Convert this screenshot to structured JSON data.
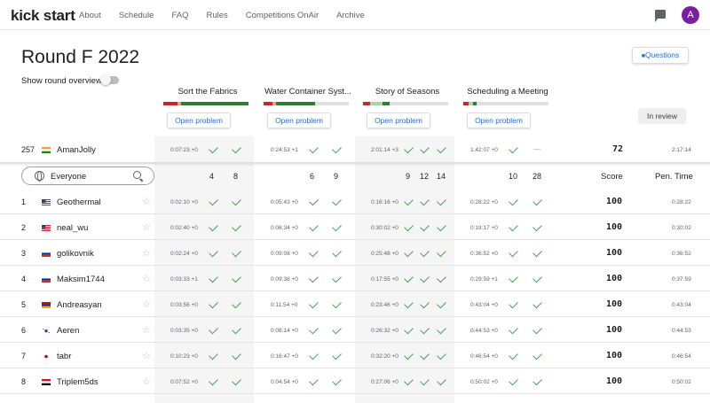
{
  "nav": {
    "logo": "kick start",
    "links": [
      "About",
      "Schedule",
      "FAQ",
      "Rules",
      "Competitions OnAir",
      "Archive"
    ],
    "avatar_letter": "A",
    "icons": [
      "feedback-icon"
    ]
  },
  "header": {
    "title": "Round F 2022",
    "questions_label": "Questions",
    "overview_label": "Show round overview",
    "review_label": "In review"
  },
  "problems": [
    {
      "name": "Sort the Fabrics",
      "open_label": "Open problem",
      "bar": [
        "#c62828",
        "#ef9a9a",
        "#2e7d32",
        "#2e7d32"
      ]
    },
    {
      "name": "Water Container Syst...",
      "open_label": "Open problem",
      "bar": [
        "#c62828",
        "#ef9a9a",
        "#2e7d32",
        "#e0e0e0"
      ]
    },
    {
      "name": "Story of Seasons",
      "open_label": "Open problem",
      "bar": [
        "#c62828",
        "#a5d6a7",
        "#2e7d32",
        "#e0e0e0"
      ]
    },
    {
      "name": "Scheduling a Meeting",
      "open_label": "Open problem",
      "bar": [
        "#c62828",
        "#a5d6a7",
        "#2e7d32",
        "#e0e0e0"
      ]
    }
  ],
  "my_row": {
    "rank": "257",
    "flag": "IN",
    "name": "AmanJolly",
    "times": [
      "0:07:23 +0",
      "0:24:53 +1",
      "2:01:14 +3",
      "1:42:07 +0"
    ],
    "placeholder_dash": "—",
    "score": "72",
    "penalty": "2:17:14"
  },
  "filter": {
    "value": "Everyone",
    "counts": [
      "4",
      "8",
      "6",
      "9",
      "9",
      "12",
      "14",
      "10",
      "28"
    ],
    "score_label": "Score",
    "pen_label": "Pen. Time"
  },
  "rows": [
    {
      "rank": "1",
      "flag": "US",
      "name": "Geothermal",
      "times": [
        "0:02:10 +0",
        "0:05:43 +0",
        "0:16:16 +0",
        "0:28:22 +0"
      ],
      "score": "100",
      "penalty": "0:28:22"
    },
    {
      "rank": "2",
      "flag": "US",
      "name": "neal_wu",
      "times": [
        "0:02:40 +0",
        "0:06:34 +0",
        "0:30:02 +0",
        "0:19:17 +0"
      ],
      "score": "100",
      "penalty": "0:30:02"
    },
    {
      "rank": "3",
      "flag": "RU",
      "name": "golikovnik",
      "times": [
        "0:02:24 +0",
        "0:09:08 +0",
        "0:25:48 +0",
        "0:36:52 +0"
      ],
      "score": "100",
      "penalty": "0:36:52"
    },
    {
      "rank": "4",
      "flag": "RU",
      "name": "Maksim1744",
      "times": [
        "0:03:33 +1",
        "0:09:38 +0",
        "0:17:55 +0",
        "0:29:59 +1"
      ],
      "score": "100",
      "penalty": "0:37:59"
    },
    {
      "rank": "5",
      "flag": "AM",
      "name": "Andreasyan",
      "times": [
        "0:03:56 +0",
        "0:11:54 +0",
        "0:23:46 +0",
        "0:43:04 +0"
      ],
      "score": "100",
      "penalty": "0:43:04"
    },
    {
      "rank": "6",
      "flag": "KR",
      "name": "Aeren",
      "times": [
        "0:03:35 +0",
        "0:08:14 +0",
        "0:26:32 +0",
        "0:44:53 +0"
      ],
      "score": "100",
      "penalty": "0:44:53"
    },
    {
      "rank": "7",
      "flag": "JP",
      "name": "tabr",
      "times": [
        "0:10:23 +0",
        "0:16:47 +0",
        "0:32:20 +0",
        "0:46:54 +0"
      ],
      "score": "100",
      "penalty": "0:46:54"
    },
    {
      "rank": "8",
      "flag": "EG",
      "name": "Triplem5ds",
      "times": [
        "0:07:52 +0",
        "0:04:54 +0",
        "0:27:06 +0",
        "0:50:02 +0"
      ],
      "score": "100",
      "penalty": "0:50:02"
    }
  ]
}
